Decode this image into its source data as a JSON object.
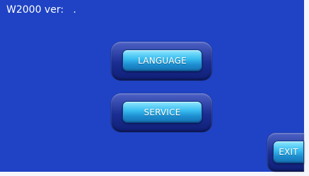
{
  "header": {
    "version_text": "W2000 ver:   ."
  },
  "menu": {
    "language_label": "LANGUAGE",
    "service_label": "SERVICE"
  },
  "footer": {
    "exit_label": "EXIT"
  },
  "colors": {
    "background": "#1f43c4",
    "button_light": "#8fe7ff",
    "button_dark": "#1673b4"
  }
}
